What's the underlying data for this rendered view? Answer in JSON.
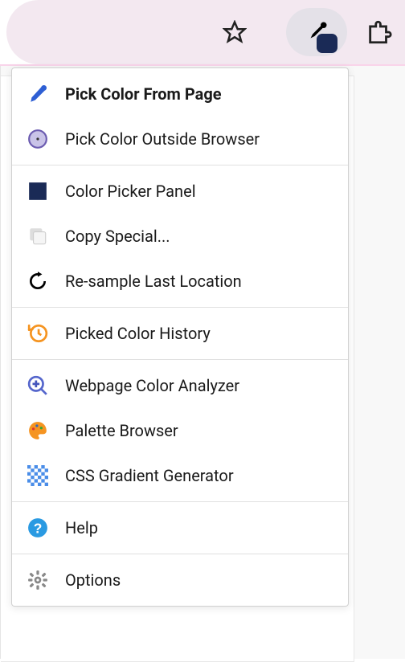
{
  "menu": {
    "groups": [
      {
        "items": [
          {
            "id": "pick-from-page",
            "label": "Pick Color From Page",
            "bold": true,
            "icon": "eyedropper-blue"
          },
          {
            "id": "pick-outside",
            "label": "Pick Color Outside Browser",
            "bold": false,
            "icon": "circle-target"
          }
        ]
      },
      {
        "items": [
          {
            "id": "color-picker-panel",
            "label": "Color Picker Panel",
            "bold": false,
            "icon": "square-navy"
          },
          {
            "id": "copy-special",
            "label": "Copy Special...",
            "bold": false,
            "icon": "copy"
          },
          {
            "id": "resample",
            "label": "Re-sample Last Location",
            "bold": false,
            "icon": "refresh"
          }
        ]
      },
      {
        "items": [
          {
            "id": "history",
            "label": "Picked Color History",
            "bold": false,
            "icon": "clock-orange"
          }
        ]
      },
      {
        "items": [
          {
            "id": "analyzer",
            "label": "Webpage Color Analyzer",
            "bold": false,
            "icon": "magnify-plus"
          },
          {
            "id": "palette",
            "label": "Palette Browser",
            "bold": false,
            "icon": "palette"
          },
          {
            "id": "gradient",
            "label": "CSS Gradient Generator",
            "bold": false,
            "icon": "checker"
          }
        ]
      },
      {
        "items": [
          {
            "id": "help",
            "label": "Help",
            "bold": false,
            "icon": "help"
          }
        ]
      },
      {
        "items": [
          {
            "id": "options",
            "label": "Options",
            "bold": false,
            "icon": "gear"
          }
        ]
      }
    ]
  }
}
